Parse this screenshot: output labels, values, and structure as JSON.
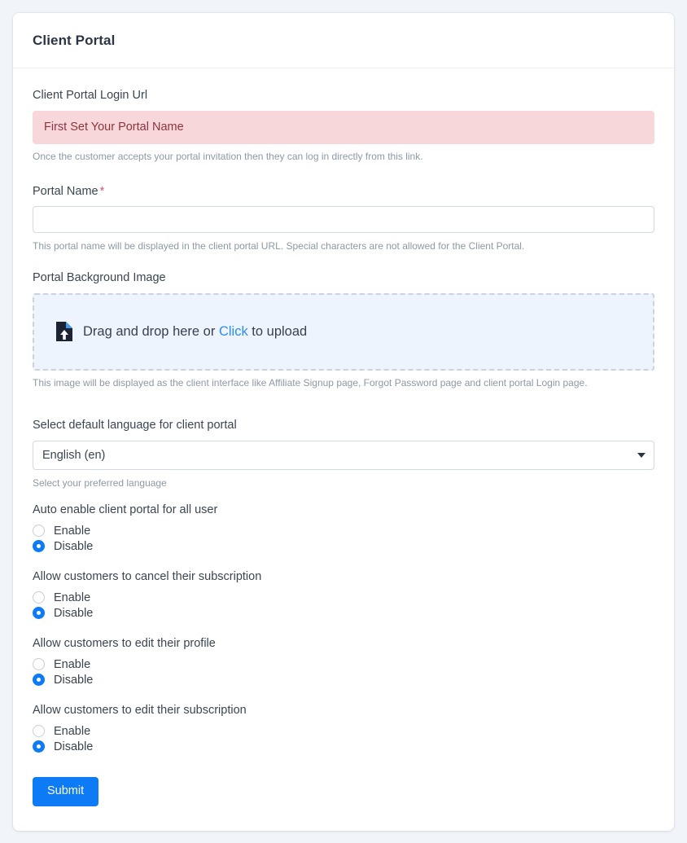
{
  "theme": {
    "page_background": "#f1f4f9",
    "card_background": "#ffffff",
    "accent": "#0c7bf5",
    "link": "#2d8cf0",
    "alert_background": "#f8d7da",
    "alert_text": "#8c3540",
    "dropzone_background": "#edf4fd",
    "required_star": "#e8546a"
  },
  "card": {
    "title": "Client Portal"
  },
  "form": {
    "login_url": {
      "label": "Client Portal Login Url",
      "alert_text": "First Set Your Portal Name",
      "help": "Once the customer accepts your portal invitation then they can log in directly from this link."
    },
    "portal_name": {
      "label": "Portal Name",
      "required_marker": "*",
      "value": "",
      "placeholder": "",
      "help": "This portal name will be displayed in the client portal URL. Special characters are not allowed for the Client Portal."
    },
    "background_image": {
      "label": "Portal Background Image",
      "dropzone_icon": "file-upload-icon",
      "dropzone_text_before": "Drag and drop here or",
      "dropzone_link": "Click",
      "dropzone_text_after": "to upload",
      "help": "This image will be displayed as the client interface like Affiliate Signup page, Forgot Password page and client portal Login page."
    },
    "language": {
      "label": "Select default language for client portal",
      "selected": "English (en)",
      "caret_icon": "caret-down-icon",
      "help": "Select your preferred language",
      "options": [
        "English (en)"
      ]
    },
    "radio_groups": [
      {
        "name": "auto-enable-client-portal",
        "label": "Auto enable client portal for all user",
        "options": [
          {
            "label": "Enable",
            "checked": false
          },
          {
            "label": "Disable",
            "checked": true
          }
        ]
      },
      {
        "name": "allow-cancel-subscription",
        "label": "Allow customers to cancel their subscription",
        "options": [
          {
            "label": "Enable",
            "checked": false
          },
          {
            "label": "Disable",
            "checked": true
          }
        ]
      },
      {
        "name": "allow-edit-profile",
        "label": "Allow customers to edit their profile",
        "options": [
          {
            "label": "Enable",
            "checked": false
          },
          {
            "label": "Disable",
            "checked": true
          }
        ]
      },
      {
        "name": "allow-edit-subscription",
        "label": "Allow customers to edit their subscription",
        "options": [
          {
            "label": "Enable",
            "checked": false
          },
          {
            "label": "Disable",
            "checked": true
          }
        ]
      }
    ],
    "submit": {
      "label": "Submit"
    }
  }
}
